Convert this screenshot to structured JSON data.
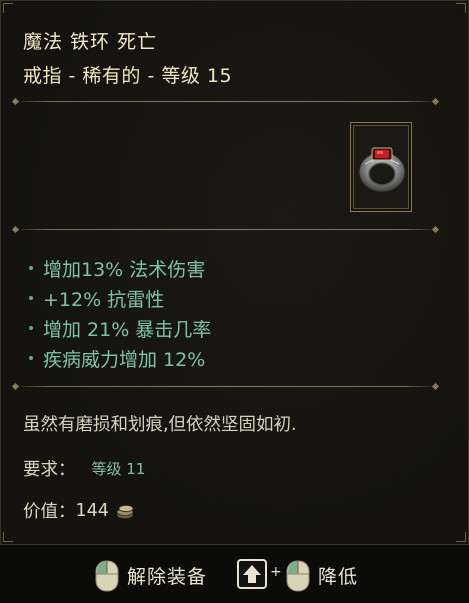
{
  "item": {
    "name": "魔法 铁环 死亡",
    "subtitle": "戒指 - 稀有的 - 等级 15",
    "icon": "iron-ring-icon",
    "stats": [
      "增加13% 法术伤害",
      "+12% 抗雷性",
      "增加 21% 暴击几率",
      "疾病威力增加 12%"
    ],
    "flavor": "虽然有磨损和划痕,但依然坚固如初.",
    "requirement_label": "要求：",
    "requirement_value": "等级 11",
    "value_label": "价值：",
    "value_amount": "144",
    "value_icon": "coin-stack-icon"
  },
  "footer": {
    "unequip_label": "解除装备",
    "second_action_label": "降低",
    "shift_key_icon": "shift-arrow-icon",
    "plus": "+"
  },
  "colors": {
    "title": "#f2e9c6",
    "stat": "#7fc2a5",
    "frame": "#8a7a52"
  }
}
